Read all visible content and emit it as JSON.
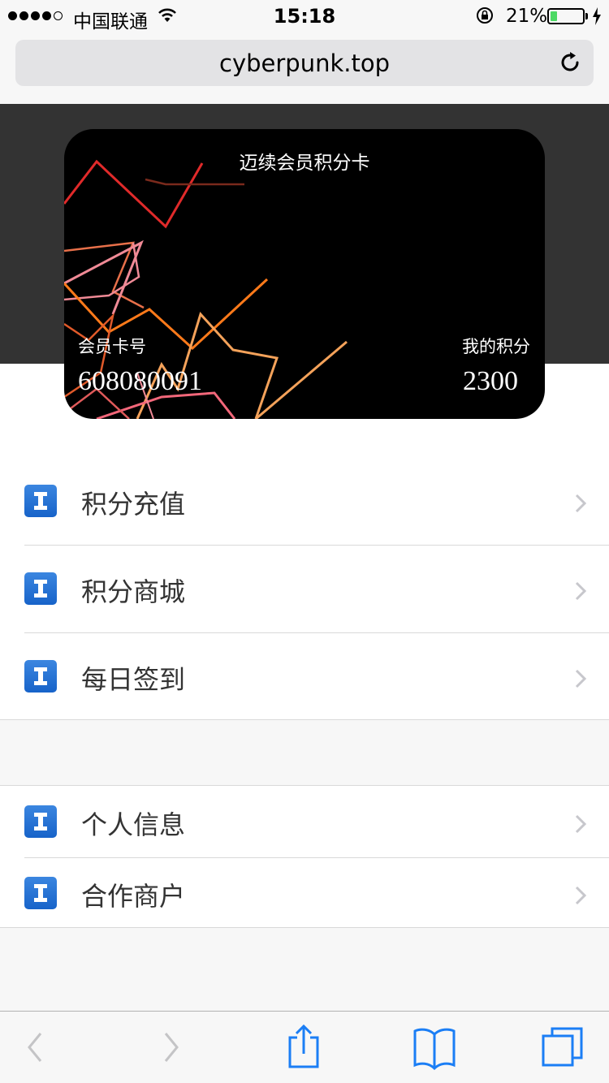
{
  "status_bar": {
    "carrier": "中国联通",
    "time": "15:18",
    "battery_percent_text": "21%",
    "battery_level": 0.21,
    "battery_fill_color": "#4cd964"
  },
  "browser": {
    "url": "cyberpunk.top",
    "reload_icon": "reload-icon"
  },
  "card": {
    "title": "迈续会员积分卡",
    "member_no_label": "会员卡号",
    "member_no": "608080091",
    "points_label": "我的积分",
    "points": "2300",
    "background_color": "#000000"
  },
  "menu": {
    "group1": [
      {
        "label": "积分充值",
        "icon": "info-icon"
      },
      {
        "label": "积分商城",
        "icon": "info-icon"
      },
      {
        "label": "每日签到",
        "icon": "info-icon"
      }
    ],
    "group2": [
      {
        "label": "个人信息",
        "icon": "info-icon"
      },
      {
        "label": "合作商户",
        "icon": "info-icon"
      }
    ]
  },
  "toolbar": {
    "back_icon": "back-icon",
    "forward_icon": "forward-icon",
    "share_icon": "share-icon",
    "bookmarks_icon": "bookmarks-icon",
    "tabs_icon": "tabs-icon"
  },
  "colors": {
    "header_band": "#333333",
    "icon_blue": "#1a6fd6",
    "toolbar_blue": "#1b7ef5"
  }
}
